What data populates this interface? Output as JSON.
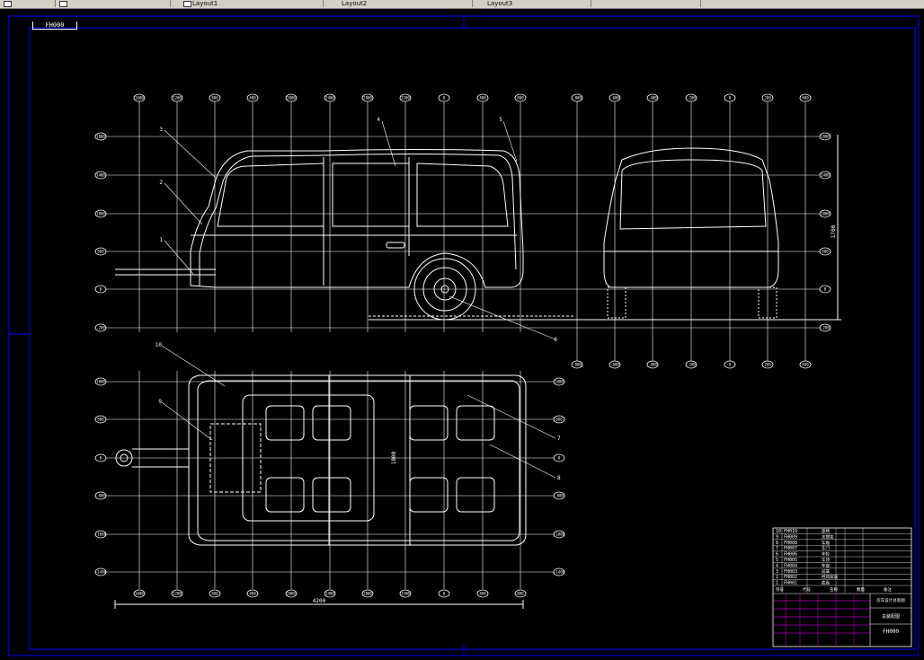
{
  "window": {
    "tabs": [
      {
        "label": ""
      },
      {
        "label": ""
      },
      {
        "label": "Layout1"
      },
      {
        "label": "Layout2"
      },
      {
        "label": "Layout3"
      },
      {
        "label": ""
      }
    ]
  },
  "sheet": {
    "label": "FH000"
  },
  "colors": {
    "background": "#000000",
    "lines": "#ffffff",
    "border": "#0000ff",
    "title_magenta": "#ff00ff"
  },
  "views": {
    "side_callouts": [
      "3",
      "2",
      "1",
      "4",
      "5",
      "6"
    ],
    "plan_callouts": [
      "10",
      "9",
      "7",
      "8"
    ],
    "overall_length_label": "4200",
    "rear_height_label": "1700",
    "plan_width_label": "1800"
  },
  "grid": {
    "top_row_bubbles": [
      "1600",
      "1200",
      "800",
      "400",
      "2000",
      "2400",
      "2800",
      "3200",
      "0",
      "400",
      "800",
      "1200"
    ],
    "right_row_bubbles": [
      "-200",
      "-400",
      "0",
      "200",
      "400",
      "600"
    ],
    "left_col_bubbles": [
      "1800",
      "1400",
      "1000",
      "600",
      "0",
      "-200"
    ],
    "plan_left_bubbles": [
      "1000",
      "600",
      "0",
      "-600",
      "-1000",
      "-1400"
    ],
    "plan_right_bubbles": [
      "1000",
      "600",
      "0",
      "-600",
      "-1000",
      "-1400"
    ],
    "rear_top_bubbles": [
      "-800",
      "-600",
      "-400",
      "-200",
      "0",
      "200",
      "400",
      "600"
    ],
    "rear_right_bubbles": [
      "1800",
      "1400",
      "1000",
      "600",
      "0",
      "-200"
    ],
    "rear_bottom_bubbles": [
      "-800",
      "-600",
      "-400",
      "-200",
      "0",
      "200",
      "400",
      "600"
    ]
  },
  "title_block": {
    "parts": [
      {
        "no": "10",
        "code": "FH010",
        "name": "座椅"
      },
      {
        "no": "9",
        "code": "FH009",
        "name": "支撑架"
      },
      {
        "no": "8",
        "code": "FH008",
        "name": "车厢"
      },
      {
        "no": "7",
        "code": "FH007",
        "name": "车门"
      },
      {
        "no": "6",
        "code": "FH006",
        "name": "车轮"
      },
      {
        "no": "5",
        "code": "FH005",
        "name": "车顶"
      },
      {
        "no": "4",
        "code": "FH004",
        "name": "车窗"
      },
      {
        "no": "3",
        "code": "FH003",
        "name": "前罩"
      },
      {
        "no": "2",
        "code": "FH002",
        "name": "挡风玻璃"
      },
      {
        "no": "1",
        "code": "FH001",
        "name": "底盘"
      }
    ],
    "header": [
      "序号",
      "代号",
      "名称",
      "数量",
      "备注"
    ],
    "project": "房车设计总装图",
    "drawing_title": "总装配图",
    "drawing_no": "FH000"
  }
}
